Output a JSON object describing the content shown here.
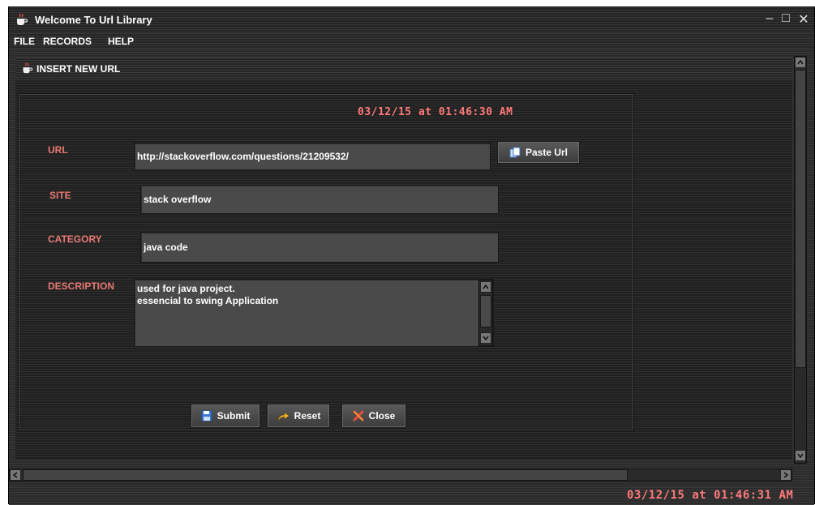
{
  "window": {
    "title": "Welcome To Url Library",
    "controls": {
      "minimize": "–",
      "maximize": "□",
      "close": "✕"
    }
  },
  "menu": [
    "FILE",
    "RECORDS",
    "HELP"
  ],
  "internal_frame": {
    "title": "INSERT NEW URL",
    "datetime": "03/12/15  at 01:46:30 AM",
    "form": {
      "url_label": "URL",
      "url_value": "http://stackoverflow.com/questions/21209532/",
      "paste_button": "Paste Url",
      "site_label": "SITE",
      "site_value": "stack overflow",
      "category_label": "CATEGORY",
      "category_value": "java code",
      "description_label": "DESCRIPTION",
      "description_value": "used for java project.\nessencial to swing Application"
    },
    "buttons": {
      "submit": "Submit",
      "reset": "Reset",
      "close": "Close"
    }
  },
  "status": {
    "datetime": "03/12/15  at 01:46:31 AM"
  },
  "icons": {
    "app": "java-cup-icon",
    "paste": "clipboard-icon",
    "submit": "save-disk-icon",
    "reset": "redo-arrow-icon",
    "close": "red-x-icon"
  },
  "colors": {
    "label": "#e67a72",
    "datetime": "#ff7a7a",
    "field_bg": "#4a4a4a"
  }
}
